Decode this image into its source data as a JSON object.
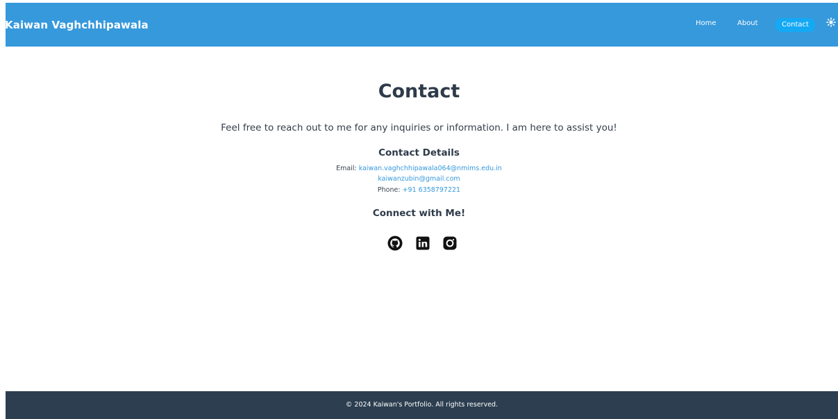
{
  "header": {
    "brand": "Kaiwan Vaghchhipawala",
    "nav": {
      "home": "Home",
      "about": "About",
      "contact": "Contact"
    },
    "theme_toggle_icon": "sun-icon",
    "active_nav": "Contact",
    "colors": {
      "background": "#3699dc",
      "active_pill": "#14a9f5"
    }
  },
  "main": {
    "title": "Contact",
    "intro": "Feel free to reach out to me for any inquiries or information. I am here to assist you!",
    "details_heading": "Contact Details",
    "email_label": "Email:",
    "email_primary": "kaiwan.vaghchhipawala064@nmims.edu.in",
    "email_secondary": "kaiwanzubin@gmail.com",
    "phone_label": "Phone:",
    "phone": "+91 6358797221",
    "connect_heading": "Connect with Me!",
    "socials": [
      "github-icon",
      "linkedin-icon",
      "instagram-icon"
    ],
    "link_color": "#3699dc"
  },
  "footer": {
    "text": "© 2024 Kaiwan's Portfolio. All rights reserved.",
    "background": "#2c3e50"
  }
}
